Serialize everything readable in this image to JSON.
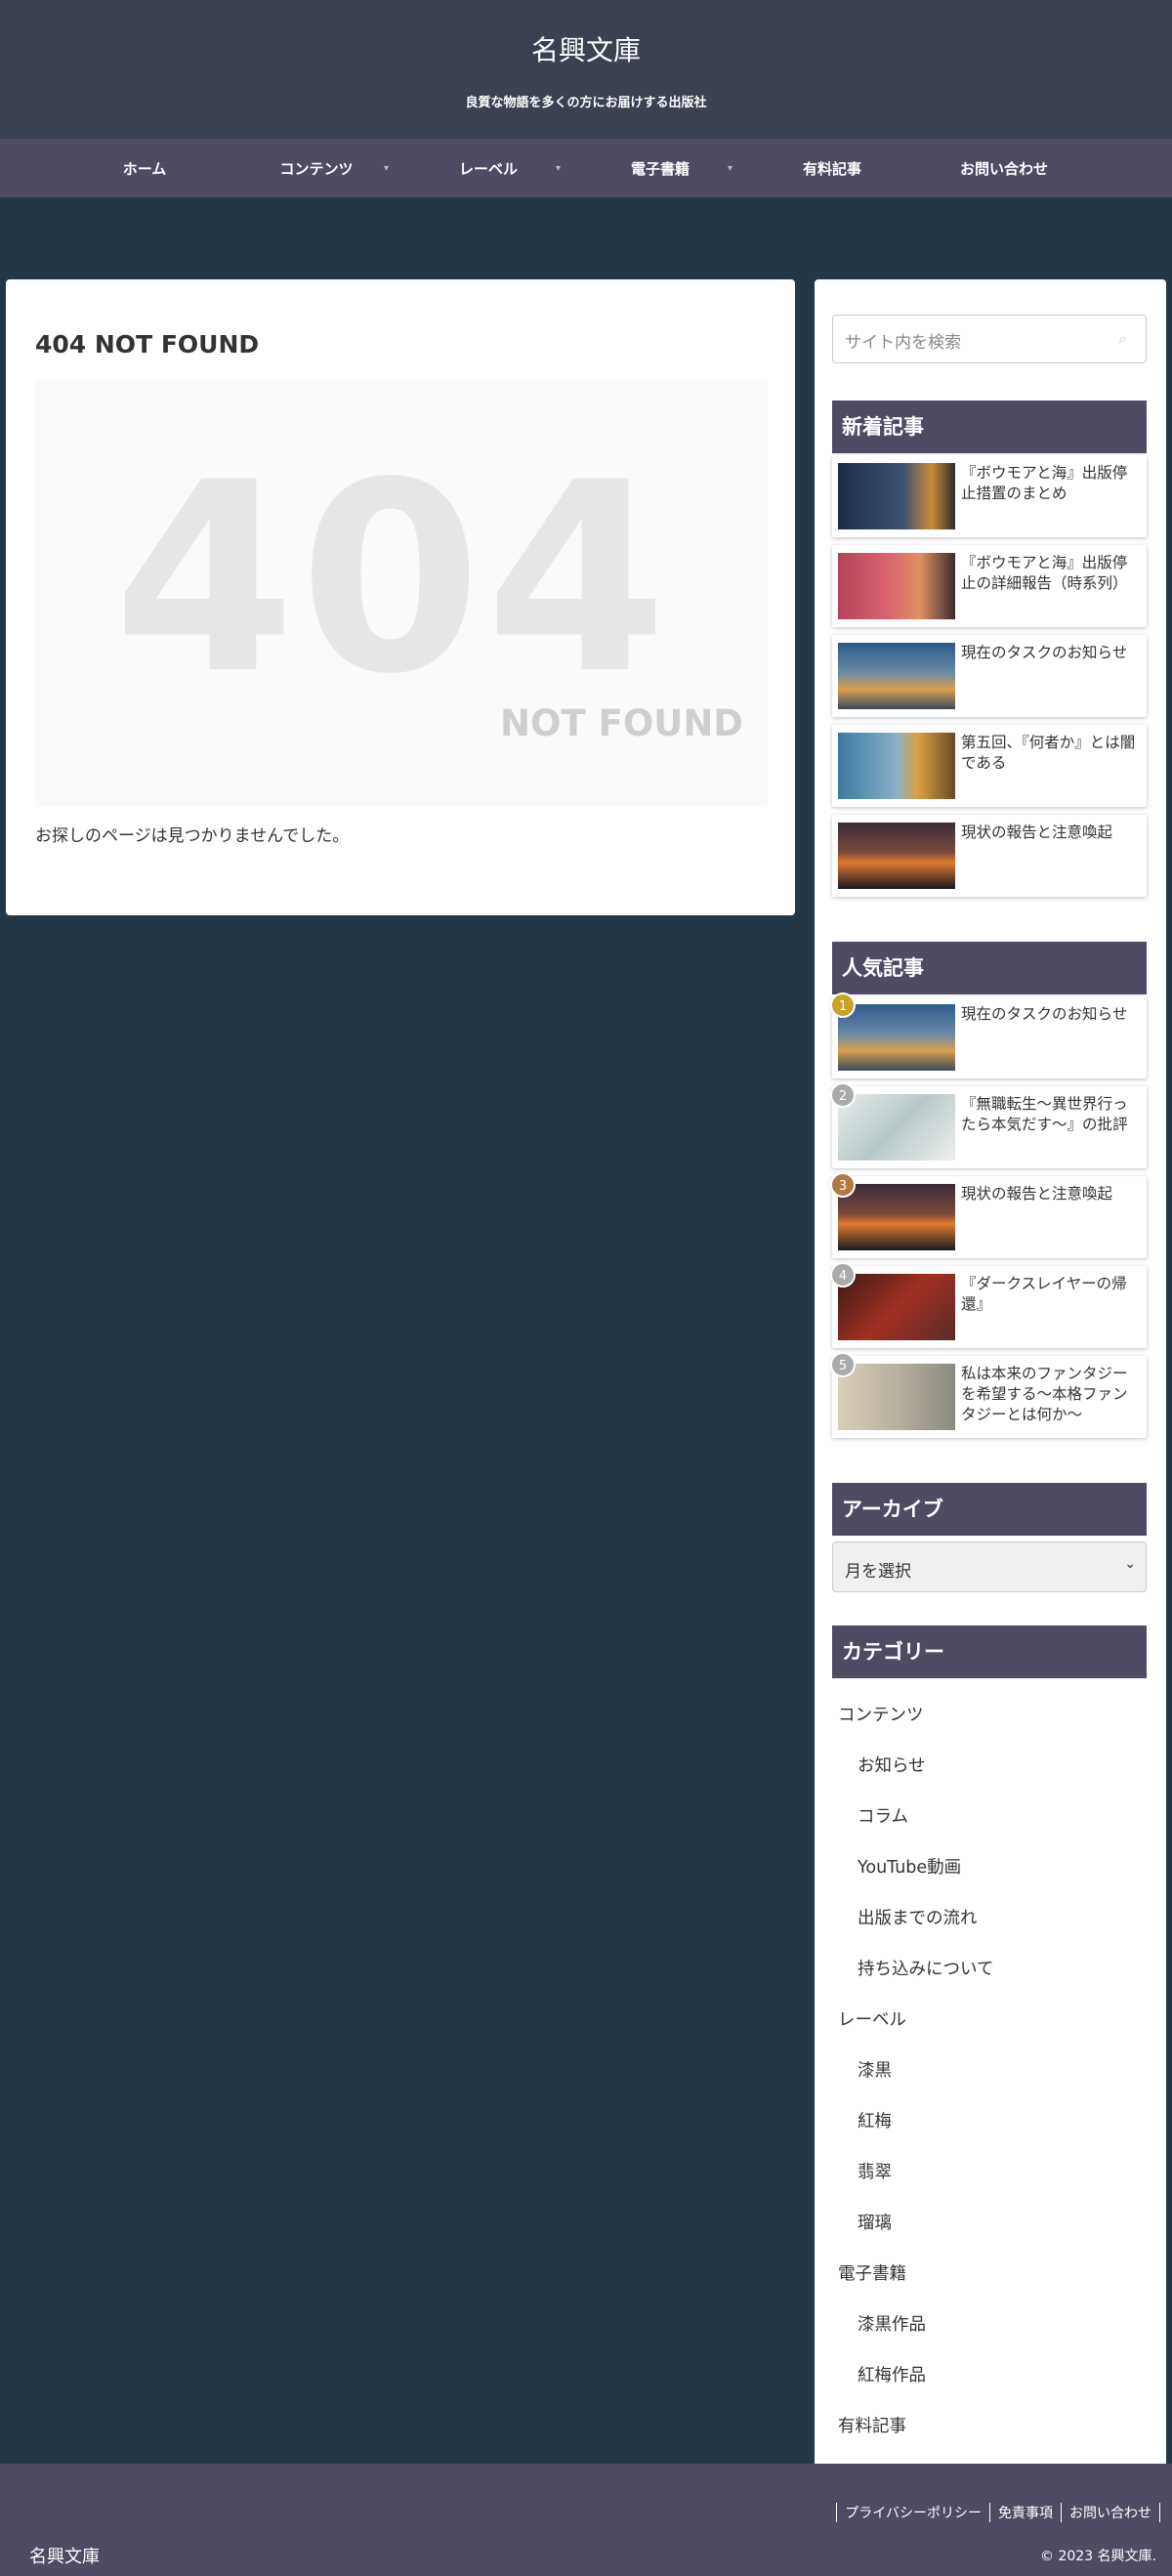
{
  "header": {
    "title": "名興文庫",
    "tagline": "良質な物語を多くの方にお届けする出版社"
  },
  "nav": [
    "ホーム",
    "コンテンツ",
    "レーベル",
    "電子書籍",
    "有料記事",
    "お問い合わせ"
  ],
  "main": {
    "title": "404 NOT FOUND",
    "big": "404",
    "sub": "NOT FOUND",
    "message": "お探しのページは見つかりませんでした。"
  },
  "sidebar": {
    "search_placeholder": "サイト内を検索",
    "new_head": "新着記事",
    "new_posts": [
      "『ボウモアと海』出版停止措置のまとめ",
      "『ボウモアと海』出版停止の詳細報告（時系列）",
      "現在のタスクのお知らせ",
      "第五回、『何者か』とは闇である",
      "現状の報告と注意喚起"
    ],
    "popular_head": "人気記事",
    "popular_posts": [
      {
        "rank": "1",
        "title": "現在のタスクのお知らせ"
      },
      {
        "rank": "2",
        "title": "『無職転生〜異世界行ったら本気だす〜』の批評"
      },
      {
        "rank": "3",
        "title": "現状の報告と注意喚起"
      },
      {
        "rank": "4",
        "title": "『ダークスレイヤーの帰還』"
      },
      {
        "rank": "5",
        "title": "私は本来のファンタジーを希望する〜本格ファンタジーとは何か〜"
      }
    ],
    "archive_head": "アーカイブ",
    "archive_select": "月を選択",
    "category_head": "カテゴリー",
    "categories": [
      "コンテンツ",
      "お知らせ",
      "コラム",
      "YouTube動画",
      "出版までの流れ",
      "持ち込みについて",
      "レーベル",
      "漆黒",
      "紅梅",
      "翡翠",
      "瑠璃",
      "電子書籍",
      "漆黒作品",
      "紅梅作品",
      "有料記事"
    ]
  },
  "footer": {
    "links": [
      "プライバシーポリシー",
      "免責事項",
      "お問い合わせ"
    ],
    "name": "名興文庫",
    "copyright": "© 2023 名興文庫."
  },
  "colors": {
    "header": "#3a4150",
    "nav": "#4e4b63",
    "body": "#233746",
    "widget": "#4e4b63"
  }
}
